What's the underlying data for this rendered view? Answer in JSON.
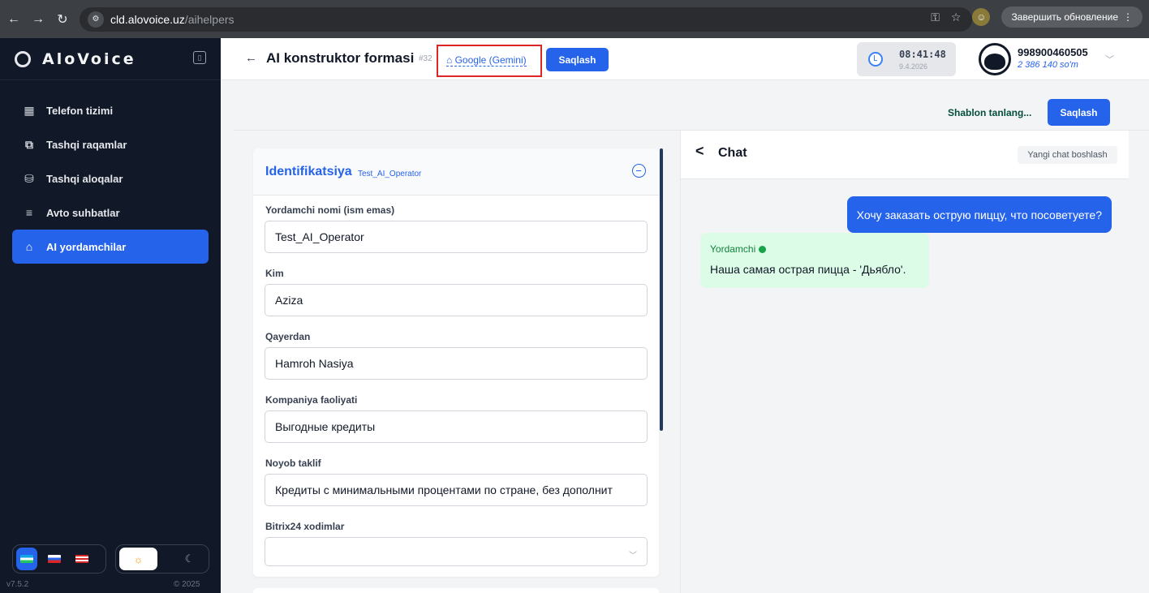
{
  "browser": {
    "url_host": "cld.alovoice.uz",
    "url_path": "/aihelpers",
    "update_button": "Завершить обновление"
  },
  "sidebar": {
    "brand": "AloVoice",
    "items": [
      {
        "label": "Telefon tizimi",
        "icon": "grid-icon"
      },
      {
        "label": "Tashqi raqamlar",
        "icon": "network-icon"
      },
      {
        "label": "Tashqi aloqalar",
        "icon": "database-icon"
      },
      {
        "label": "Avto suhbatlar",
        "icon": "list-icon"
      },
      {
        "label": "AI yordamchilar",
        "icon": "robot-icon",
        "active": true
      }
    ],
    "version": "v7.5.2",
    "copyright": "© 2025"
  },
  "header": {
    "title": "AI konstruktor formasi",
    "record_id": "#32",
    "model": "Google (Gemini)",
    "save_label": "Saqlash",
    "time": "08:41:48",
    "date": "9.4.2026",
    "user_phone": "998900460505",
    "user_balance": "2 386 140 so'm"
  },
  "actions": {
    "template_label": "Shablon tanlang...",
    "save_label": "Saqlash"
  },
  "form": {
    "section_title": "Identifikatsiya",
    "section_subtitle": "Test_AI_Operator",
    "fields": [
      {
        "label": "Yordamchi nomi (ism emas)",
        "value": "Test_AI_Operator"
      },
      {
        "label": "Kim",
        "value": "Aziza"
      },
      {
        "label": "Qayerdan",
        "value": "Hamroh Nasiya"
      },
      {
        "label": "Kompaniya faoliyati",
        "value": "Выгодные кредиты"
      },
      {
        "label": "Noyob taklif",
        "value": "Кредиты с минимальными процентами по стране, без дополнит"
      },
      {
        "label": "Bitrix24 xodimlar",
        "value": ""
      }
    ]
  },
  "chat": {
    "title": "Chat",
    "new_chat_label": "Yangi chat boshlash",
    "user_message": "Хочу заказать острую пиццу, что посоветуете?",
    "bot_name": "Yordamchi",
    "bot_message": "Наша самая острая пицца - 'Дьябло'."
  },
  "colors": {
    "accent": "#2563eb",
    "sidebar_bg": "#111827",
    "highlight_border": "#dc2626",
    "bot_bubble": "#dcfce7"
  }
}
